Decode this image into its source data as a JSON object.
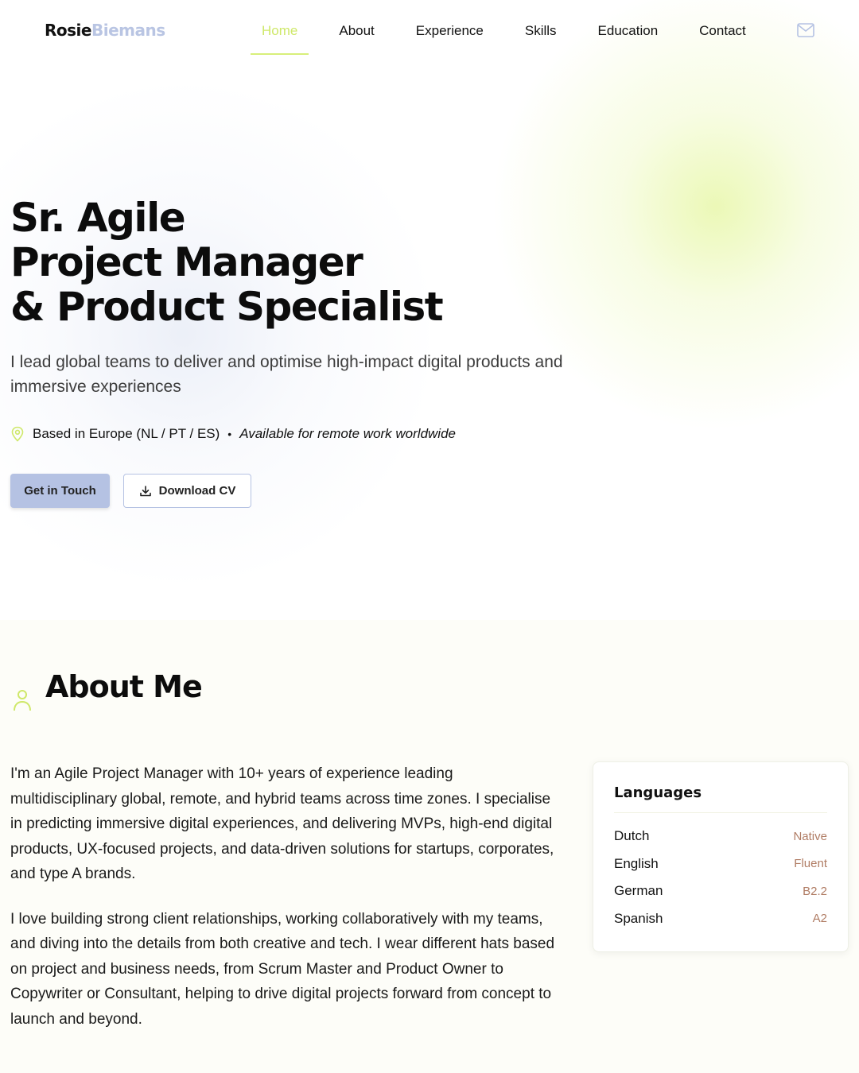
{
  "nav": {
    "logo_first": "Rosie",
    "logo_last": "Biemans",
    "links": [
      {
        "label": "Home",
        "active": true
      },
      {
        "label": "About"
      },
      {
        "label": "Experience"
      },
      {
        "label": "Skills"
      },
      {
        "label": "Education"
      },
      {
        "label": "Contact"
      }
    ],
    "mail_icon": "mail-icon"
  },
  "hero": {
    "title_lines": [
      "Sr. Agile",
      "Project Manager",
      "& Product Specialist"
    ],
    "subtitle": "I lead global teams to deliver and optimise high-impact digital products and immersive experiences",
    "location": "Based in Europe (NL / PT / ES)",
    "separator": "•",
    "availability": "Available for remote work worldwide",
    "primary_button": "Get in Touch",
    "secondary_button": "Download CV"
  },
  "about": {
    "title": "About Me",
    "paragraphs": [
      "I'm an Agile Project Manager with 10+ years of experience leading multidisciplinary global, remote, and hybrid teams across time zones. I specialise in predicting immersive digital experiences, and delivering MVPs, high-end digital products, UX-focused projects, and data-driven solutions for startups, corporates, and type A brands.",
      "I love building strong client relationships, working collaboratively with my teams, and diving into the details from both creative and tech. I wear different hats based on project and business needs, from Scrum Master and Product Owner to Copywriter or Consultant, helping to drive digital projects forward from concept to launch and beyond."
    ]
  },
  "languages": {
    "title": "Languages",
    "items": [
      {
        "name": "Dutch",
        "level": "Native"
      },
      {
        "name": "English",
        "level": "Fluent"
      },
      {
        "name": "German",
        "level": "B2.2"
      },
      {
        "name": "Spanish",
        "level": "A2"
      }
    ]
  },
  "colors": {
    "accent_lime": "#d7ef7a",
    "accent_blue": "#b5c2e3",
    "level_text": "#b07c64"
  }
}
